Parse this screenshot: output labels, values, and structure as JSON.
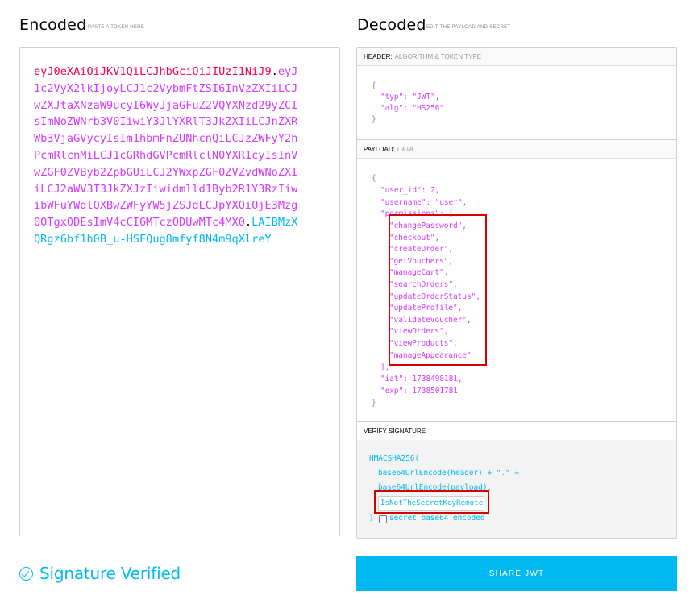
{
  "encoded": {
    "title": "Encoded",
    "subtitle": "PASTE A TOKEN HERE",
    "token": {
      "header": "eyJ0eXAiOiJKV1QiLCJhbGciOiJIUzI1NiJ9",
      "payload": "eyJ1c2VyX2lkIjoyLCJ1c2VybmFtZSI6InVzZXIiLCJwZXJtaXNzaW9ucyI6WyJjaGFuZ2VQYXNzd29yZCIsImNoZWNrb3V0IiwiY3JlYXRlT3JkZXIiLCJnZXRWb3VjaGVycyIsIm1hbmFnZUNhcnQiLCJzZWFyY2hPcmRlcnMiLCJ1cGRhdGVPcmRlclN0YXR1cyIsInVwZGF0ZVByb2ZpbGUiLCJ2YWxpZGF0ZVZvdWNoZXIiLCJ2aWV3T3JkZXJzIiwidmlld1Byb2R1Y3RzIiwibWFuYWdlQXBwZWFyYW5jZSJdLCJpYXQiOjE3Mzg0OTgxODEsImV4cCI6MTczODUwMTc4MX0",
      "signature": "LAIBMzXQRgz6bf1h0B_u-HSFQug8mfyf8N4m9qXlreY",
      "dot": "."
    }
  },
  "decoded": {
    "title": "Decoded",
    "subtitle": "EDIT THE PAYLOAD AND SECRET",
    "header_section": {
      "label": "HEADER:",
      "sublabel": "ALGORITHM & TOKEN TYPE",
      "open": "{",
      "typ_line": "\"typ\": \"JWT\",",
      "alg_line": "\"alg\": \"HS256\"",
      "close": "}"
    },
    "payload_section": {
      "label": "PAYLOAD:",
      "sublabel": "DATA",
      "open": "{",
      "user_id_line": "\"user_id\": 2,",
      "username_line": "\"username\": \"user\",",
      "permissions_line": "\"permissions\": [",
      "permissions": [
        "\"changePassword\",",
        "\"checkout\",",
        "\"createOrder\",",
        "\"getVouchers\",",
        "\"manageCart\",",
        "\"searchOrders\",",
        "\"updateOrderStatus\",",
        "\"updateProfile\",",
        "\"validateVoucher\",",
        "\"viewOrders\",",
        "\"viewProducts\",",
        "\"manageAppearance\""
      ],
      "permissions_close": "],",
      "iat_line": "\"iat\": 1738498181,",
      "exp_line": "\"exp\": 1738501781",
      "close": "}"
    },
    "verify_section": {
      "label": "VERIFY SIGNATURE",
      "line1": "HMACSHA256(",
      "line2": "base64UrlEncode(header) + \".\" +",
      "line3": "base64UrlEncode(payload),",
      "secret_value": "IsNotTheSecretKeyRemote",
      "close": ")",
      "b64_label": "secret base64 encoded"
    }
  },
  "footer": {
    "verified_text": "Signature Verified",
    "share_label": "SHARE JWT"
  },
  "colors": {
    "header": "#fb015b",
    "payload": "#d63aff",
    "signature": "#00b9f1",
    "highlight": "#d20000"
  }
}
